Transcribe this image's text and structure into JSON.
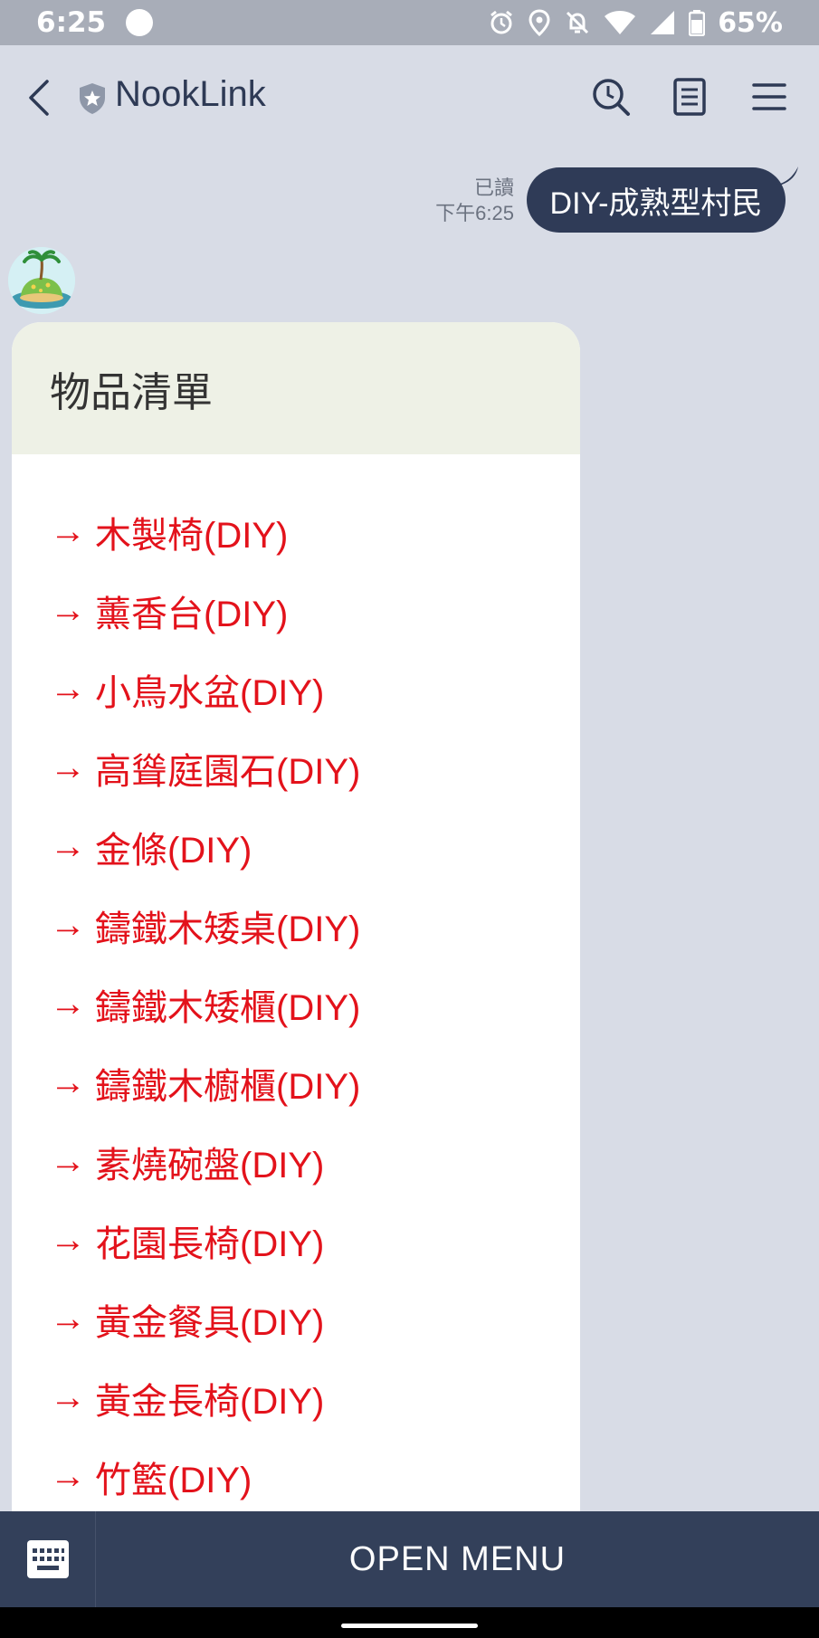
{
  "status_bar": {
    "time": "6:25",
    "battery": "65%"
  },
  "header": {
    "title": "NookLink"
  },
  "sent_message": {
    "read_label": "已讀",
    "time": "下午6:25",
    "text": "DIY-成熟型村民"
  },
  "card": {
    "title": "物品清單",
    "arrow": "→",
    "items": [
      "木製椅(DIY)",
      "薰香台(DIY)",
      "小鳥水盆(DIY)",
      "高聳庭園石(DIY)",
      "金條(DIY)",
      "鑄鐵木矮桌(DIY)",
      "鑄鐵木矮櫃(DIY)",
      "鑄鐵木櫥櫃(DIY)",
      "素燒碗盤(DIY)",
      "花園長椅(DIY)",
      "黃金餐具(DIY)",
      "黃金長椅(DIY)",
      "竹籃(DIY)"
    ],
    "item_color": "#e3121b"
  },
  "bottom_bar": {
    "open_menu_label": "OPEN MENU"
  },
  "colors": {
    "background": "#d8dce6",
    "bubble": "#2f3b57",
    "bottom_bar": "#33405a",
    "card_header": "#eef1e6"
  }
}
